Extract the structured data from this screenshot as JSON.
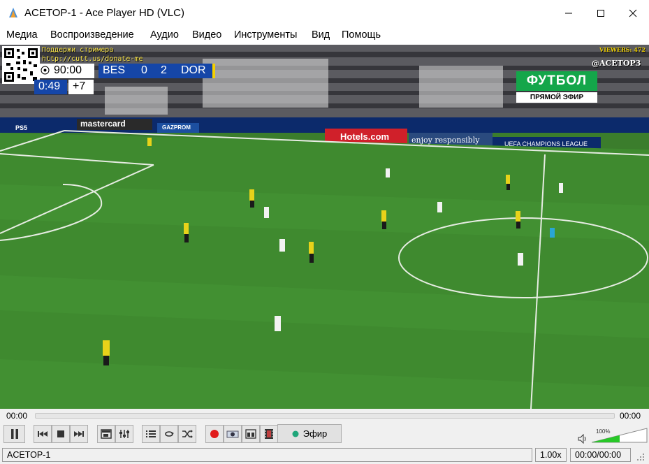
{
  "window": {
    "title": "ACETOP-1 - Ace Player HD (VLC)"
  },
  "menu": [
    "Медиа",
    "Воспроизведение",
    "Аудио",
    "Видео",
    "Инструменты",
    "Вид",
    "Помощь"
  ],
  "video": {
    "donate_line1": "Поддержи стримера",
    "donate_line2": "http://cutt.us/donate-me",
    "viewers": "VIEWERS: 472",
    "handle": "@ACETOP3",
    "scoreboard": {
      "clock": "90:00",
      "home": "BES",
      "home_score": "0",
      "away_score": "2",
      "away": "DOR",
      "added_time_clock": "0:49",
      "added_time": "+7"
    },
    "channel": {
      "name": "ФУТБОЛ",
      "live": "ПРЯМОЙ ЭФИР"
    },
    "boards": [
      "mastercard",
      "GAZPROM",
      "Hotels.com",
      "enjoy responsibly",
      "UEFA CHAMPIONS LEAGUE",
      "PS5"
    ]
  },
  "seek": {
    "elapsed": "00:00",
    "remaining": "00:00",
    "progress": 0.0
  },
  "controls": {
    "live_button": "Эфир",
    "volume_percent": "100%",
    "volume_level": 1.0
  },
  "status": {
    "channel": "ACETOP-1",
    "speed": "1.00x",
    "time": "00:00/00:00"
  },
  "colors": {
    "accent_live": "#1fa67a",
    "record": "#e11b1b",
    "volume": "#28c828"
  }
}
